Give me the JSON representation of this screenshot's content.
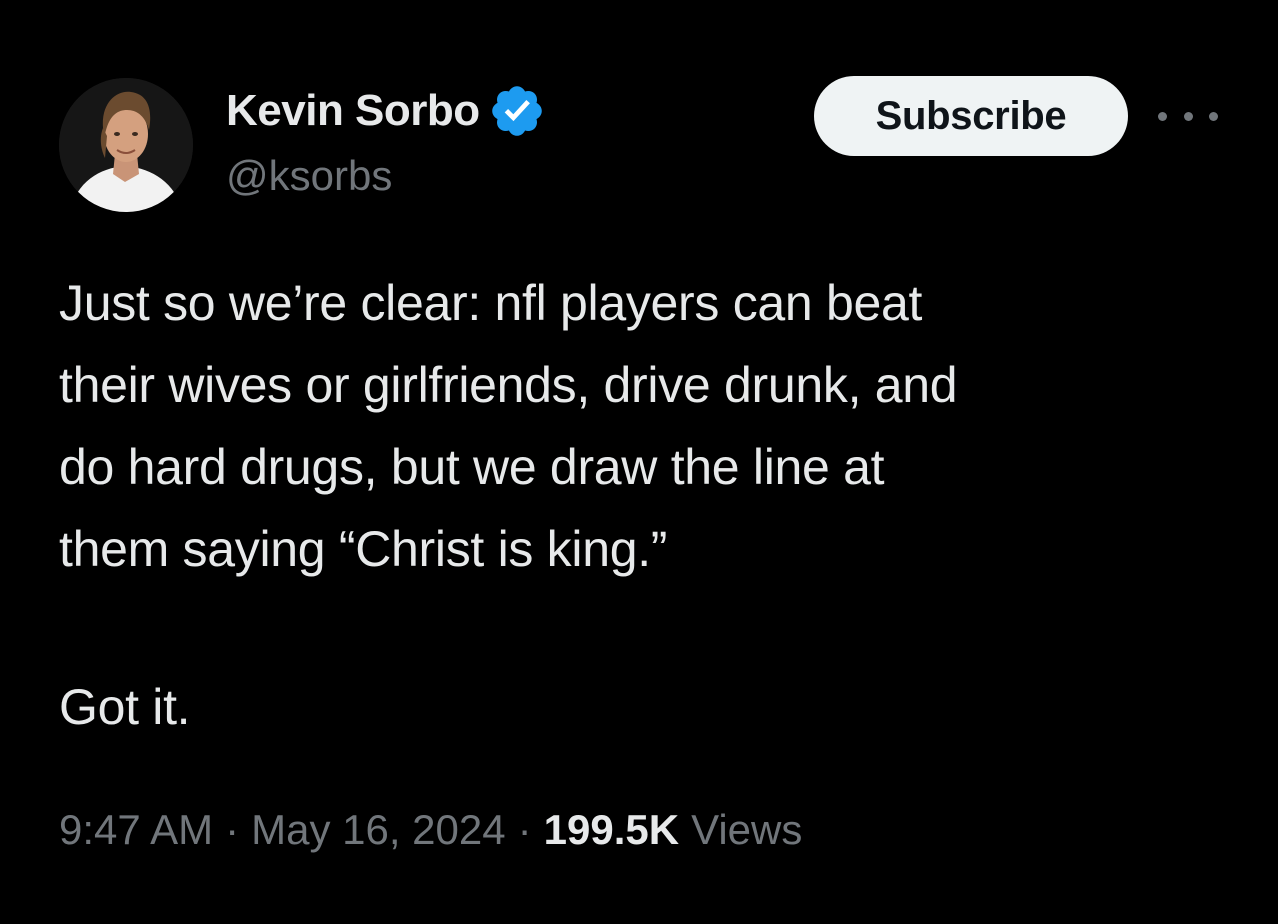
{
  "author": {
    "display_name": "Kevin Sorbo",
    "handle": "@ksorbs",
    "verified": true,
    "avatar_alt": "avatar"
  },
  "actions": {
    "subscribe_label": "Subscribe",
    "more_icon": "more-horizontal-icon"
  },
  "tweet": {
    "text": "Just so we’re clear: nfl players can beat\ntheir wives or girlfriends, drive drunk, and\ndo hard drugs, but we draw the line at\nthem saying “Christ is king.”",
    "closing": "Got it."
  },
  "meta": {
    "time": "9:47 AM",
    "separator": "·",
    "date": "May 16, 2024",
    "views_count": "199.5K",
    "views_label": "Views"
  },
  "colors": {
    "background": "#000000",
    "text_primary": "#e7e9ea",
    "text_secondary": "#71767b",
    "verified_blue": "#1d9bf0",
    "subscribe_bg": "#eff3f4"
  }
}
